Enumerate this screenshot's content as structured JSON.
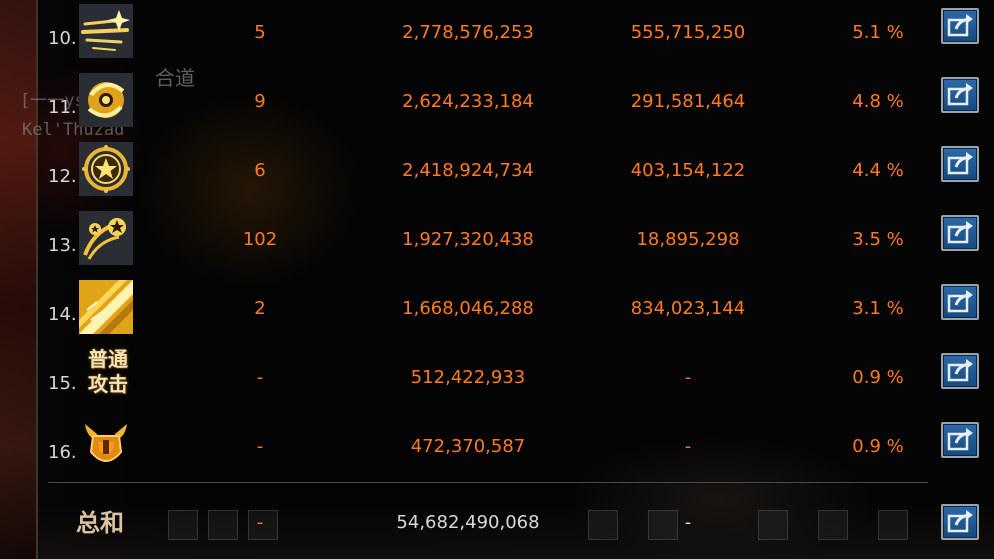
{
  "background": {
    "character_tag": "[一一ys一]",
    "character_name": "Kel'Thuzad",
    "title_fragment": "合道"
  },
  "rows": [
    {
      "rank": "10.",
      "icon": "golden-slash-streaks-icon",
      "hits": "5",
      "total": "2,778,576,253",
      "per_hit": "555,715,250",
      "percent": "5.1 %"
    },
    {
      "rank": "11.",
      "icon": "golden-swirl-orb-icon",
      "hits": "9",
      "total": "2,624,233,184",
      "per_hit": "291,581,464",
      "percent": "4.8 %"
    },
    {
      "rank": "12.",
      "icon": "star-ring-emblem-icon",
      "hits": "6",
      "total": "2,418,924,734",
      "per_hit": "403,154,122",
      "percent": "4.4 %"
    },
    {
      "rank": "13.",
      "icon": "comet-stars-icon",
      "hits": "102",
      "total": "1,927,320,438",
      "per_hit": "18,895,298",
      "percent": "3.5 %"
    },
    {
      "rank": "14.",
      "icon": "golden-blade-flash-icon",
      "hits": "2",
      "total": "1,668,046,288",
      "per_hit": "834,023,144",
      "percent": "3.1 %"
    },
    {
      "rank": "15.",
      "icon_text": [
        "普通",
        "攻击"
      ],
      "hits": "-",
      "total": "512,422,933",
      "per_hit": "-",
      "percent": "0.9 %"
    },
    {
      "rank": "16.",
      "icon": "horned-helmet-shield-icon",
      "hits": "-",
      "total": "472,370,587",
      "per_hit": "-",
      "percent": "0.9 %"
    }
  ],
  "summary": {
    "label": "总和",
    "hits": "-",
    "total": "54,682,490,068",
    "per_hit": "-"
  },
  "colors": {
    "value_orange": "#ff7a1e",
    "rank_gray": "#d6d6d6",
    "button_blue": "#1f5a94",
    "gold": "#f2c23a"
  }
}
